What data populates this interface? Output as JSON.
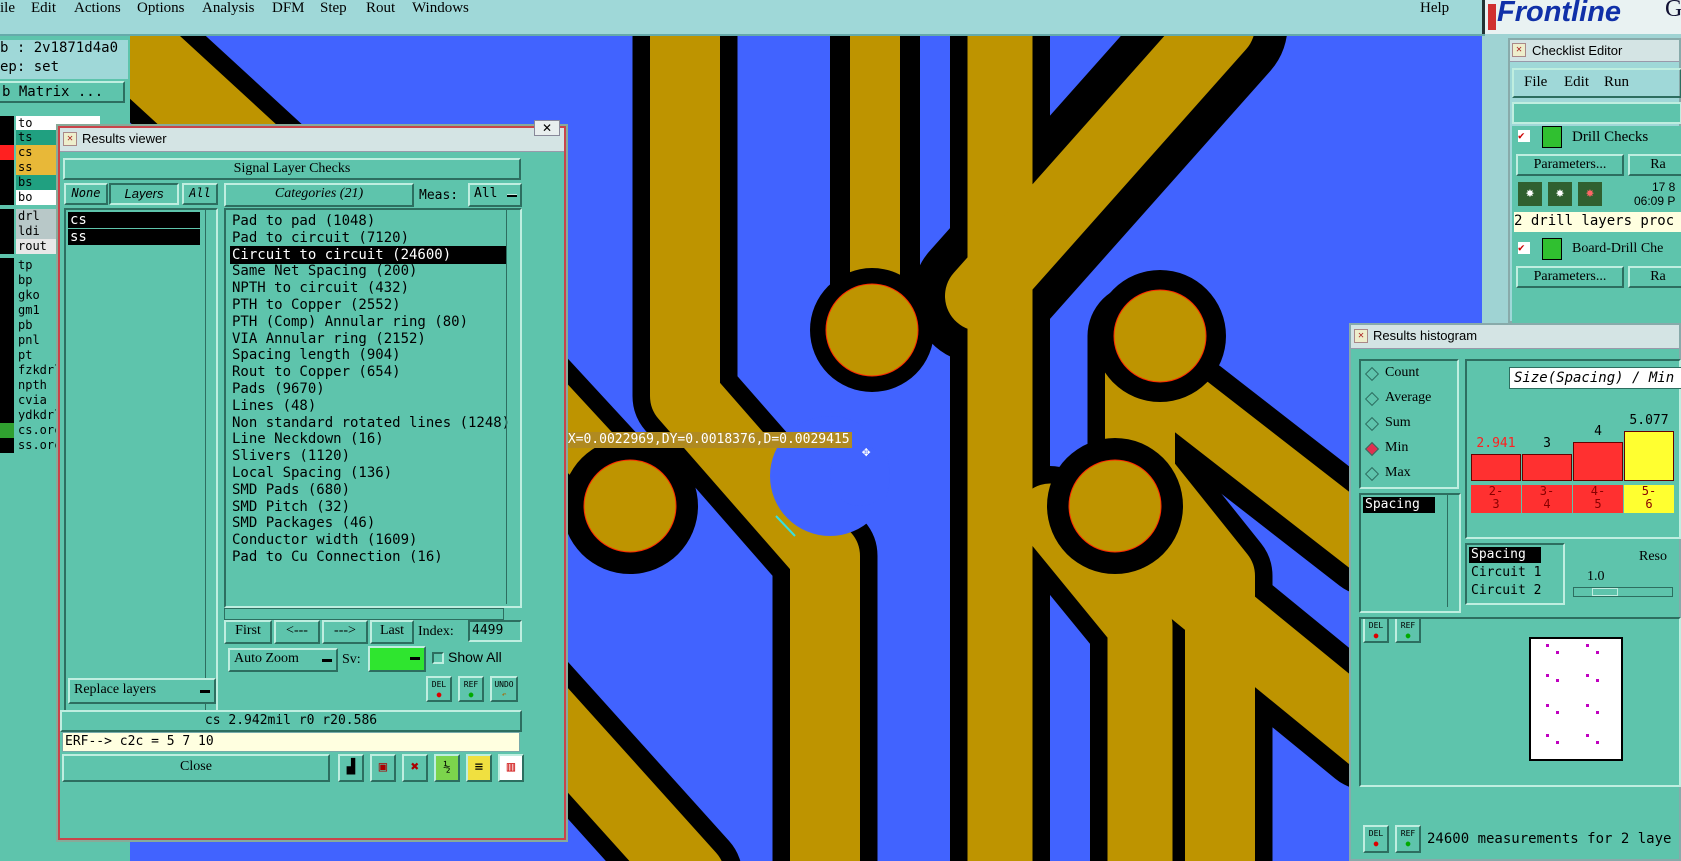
{
  "menubar": {
    "items": [
      "ile",
      "Edit",
      "Actions",
      "Options",
      "Analysis",
      "DFM",
      "Step",
      "Rout",
      "Windows"
    ],
    "help": "Help",
    "logo": "Frontline",
    "logo_suffix": "G"
  },
  "leftpanel": {
    "job": "b : 2v1871d4a0",
    "step": "ep: set",
    "matrix_button": "b Matrix ...",
    "layers": [
      {
        "name": "to",
        "color": "#ffffff",
        "sw": "#000000"
      },
      {
        "name": "ts",
        "color": "#20a080",
        "sw": "#000000"
      },
      {
        "name": "cs",
        "color": "#e8b838",
        "sw": "#ff2020"
      },
      {
        "name": "ss",
        "color": "#e8b838",
        "sw": "#000000"
      },
      {
        "name": "bs",
        "color": "#20a080",
        "sw": "#000000"
      },
      {
        "name": "bo",
        "color": "#ffffff",
        "sw": "#000000"
      },
      {
        "name": "drl",
        "color": "#b8c8c8",
        "sw": "#000000"
      },
      {
        "name": "ldi",
        "color": "#b8c8c8",
        "sw": "#000000"
      },
      {
        "name": "rout",
        "color": "#e8e8e8",
        "sw": "#000000"
      },
      {
        "name": "tp",
        "color": "#5ec4ac",
        "sw": "#000000"
      },
      {
        "name": "bp",
        "color": "#5ec4ac",
        "sw": "#000000"
      },
      {
        "name": "gko",
        "color": "#5ec4ac",
        "sw": "#000000"
      },
      {
        "name": "gm1",
        "color": "#5ec4ac",
        "sw": "#000000"
      },
      {
        "name": "pb",
        "color": "#5ec4ac",
        "sw": "#000000"
      },
      {
        "name": "pnl",
        "color": "#5ec4ac",
        "sw": "#000000"
      },
      {
        "name": "pt",
        "color": "#5ec4ac",
        "sw": "#000000"
      },
      {
        "name": "fzkdrl",
        "color": "#5ec4ac",
        "sw": "#000000"
      },
      {
        "name": "npth",
        "color": "#5ec4ac",
        "sw": "#000000"
      },
      {
        "name": "cvia",
        "color": "#5ec4ac",
        "sw": "#000000"
      },
      {
        "name": "ydkdrl",
        "color": "#5ec4ac",
        "sw": "#000000"
      },
      {
        "name": "cs.orc",
        "color": "#5ec4ac",
        "sw": "#30a030"
      },
      {
        "name": "ss.orc",
        "color": "#5ec4ac",
        "sw": "#000000"
      }
    ]
  },
  "canvas": {
    "measurement": "DX=0.0022969,DY=0.0018376,D=0.0029415"
  },
  "results_viewer": {
    "title": "Results viewer",
    "header": "Signal Layer Checks",
    "none_btn": "None",
    "layers_btn": "Layers",
    "all_btn": "All",
    "layer_list": [
      "cs",
      "ss"
    ],
    "categories_btn": "Categories (21)",
    "meas_label": "Meas:",
    "meas_value": "All",
    "categories": [
      "Pad to pad (1048)",
      "Pad to circuit (7120)",
      "Circuit to circuit (24600)",
      "Same Net Spacing (200)",
      "NPTH to circuit (432)",
      "PTH to Copper (2552)",
      "PTH (Comp) Annular ring (80)",
      "VIA Annular ring (2152)",
      "Spacing length (904)",
      "Rout to Copper (654)",
      "Pads (9670)",
      "Lines (48)",
      "Non standard rotated lines (1248)",
      "Line Neckdown (16)",
      "Slivers (1120)",
      "Local Spacing (136)",
      "SMD Pads (680)",
      "SMD Pitch (32)",
      "SMD Packages (46)",
      "Conductor width (1609)",
      "Pad to Cu Connection (16)"
    ],
    "selected_category": "Circuit to circuit (24600)",
    "first_btn": "First",
    "prev_btn": "<---",
    "next_btn": "--->",
    "last_btn": "Last",
    "index_label": "Index:",
    "index_value": "4499",
    "autozoom": "Auto Zoom",
    "sv_label": "Sv:",
    "show_all": "Show All",
    "replace_layers": "Replace layers",
    "del": "DEL",
    "ref": "REF",
    "undo": "UNDO",
    "status": "cs 2.942mil  r0  r20.586",
    "erf": "ERF--> c2c = 5 7 10",
    "close": "Close"
  },
  "checklist": {
    "title": "Checklist Editor",
    "menu": [
      "File",
      "Edit",
      "Run"
    ],
    "drill_checks": "Drill Checks",
    "params": "Parameters...",
    "ra": "Ra",
    "date1": "17 8",
    "date2": "06:09 P",
    "drill_msg": "2 drill layers proc",
    "board_drill": "Board-Drill Che",
    "params2": "Parameters...",
    "ra2": "Ra"
  },
  "histogram": {
    "title": "Results histogram",
    "options": [
      "Count",
      "Average",
      "Sum",
      "Min",
      "Max"
    ],
    "selected": "Min",
    "heading": "Size(Spacing) / Min",
    "list": [
      "Spacing"
    ],
    "list2": [
      "Spacing",
      "Circuit 1",
      "Circuit 2"
    ],
    "res_label": "Reso",
    "res_value": "1.0",
    "bars": [
      {
        "value": "2.941",
        "range": "2-\n3",
        "color": "#ff3030",
        "h": 0.38,
        "valcolor": "#ff2020"
      },
      {
        "value": "3",
        "range": "3-\n4",
        "color": "#ff3030",
        "h": 0.38,
        "valcolor": "#000"
      },
      {
        "value": "4",
        "range": "4-\n5",
        "color": "#ff3030",
        "h": 0.55,
        "valcolor": "#000"
      },
      {
        "value": "5.077",
        "range": "5-\n6",
        "color": "#ffff30",
        "h": 0.72,
        "valcolor": "#000"
      }
    ],
    "footer": "24600 measurements for 2 laye",
    "del": "DEL",
    "ref": "REF"
  },
  "colors": {
    "panel": "#5ec4ac",
    "board": "#4163ff",
    "copper": "#be9400"
  }
}
